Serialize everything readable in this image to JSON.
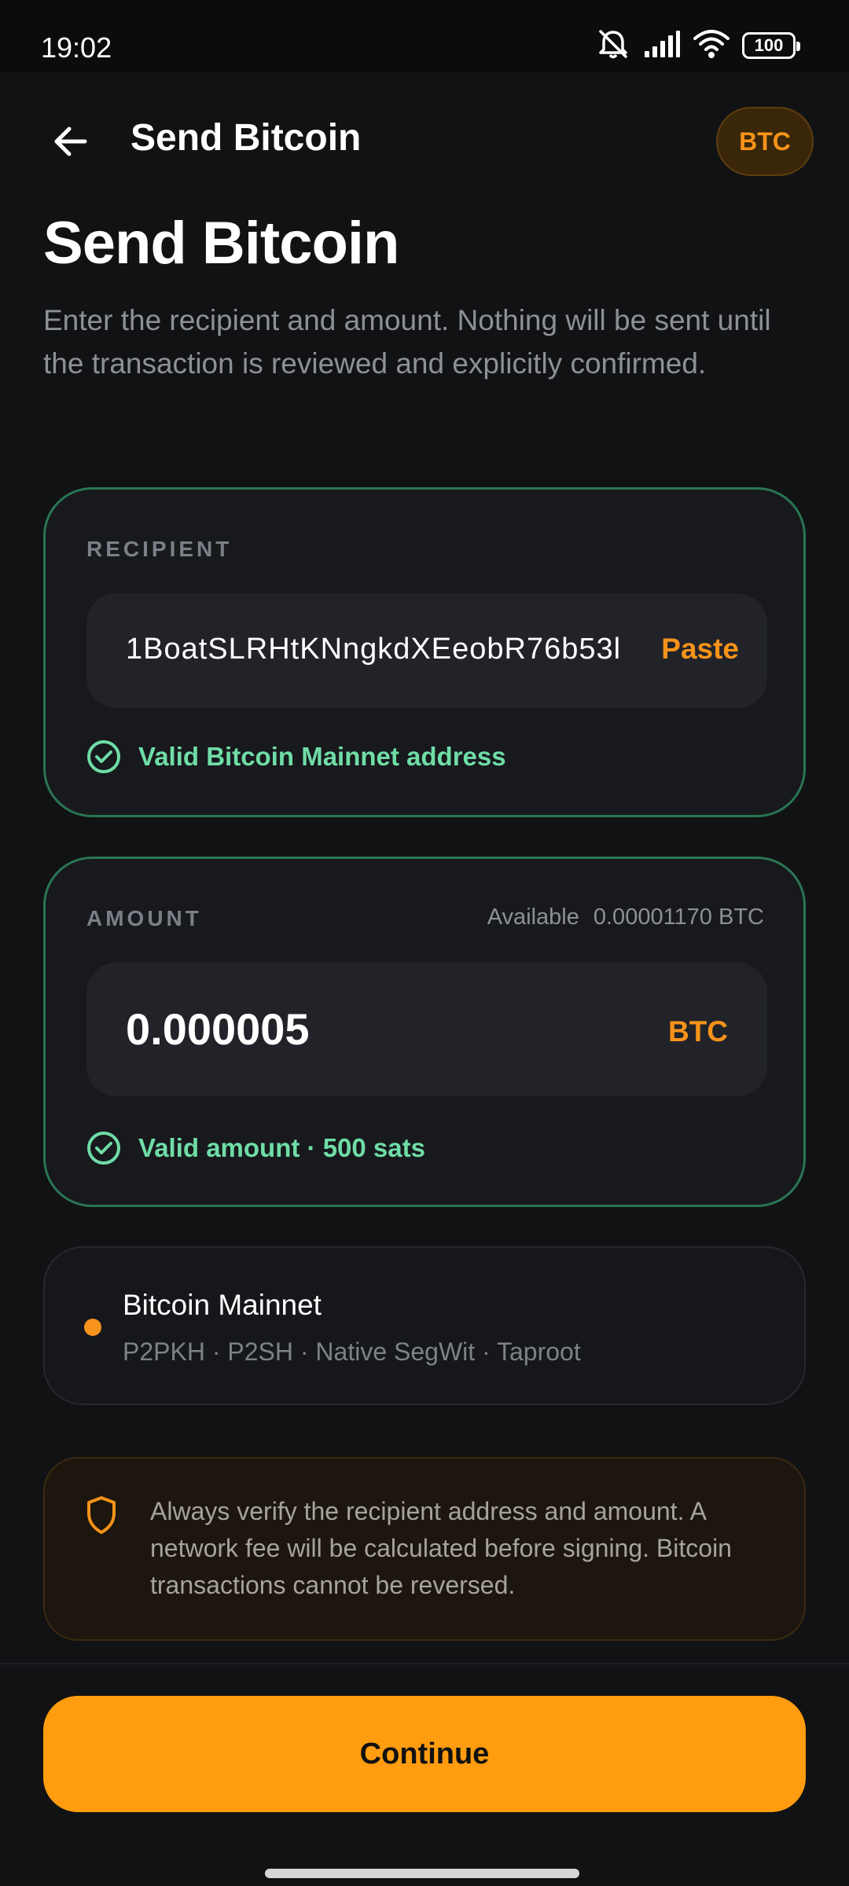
{
  "status_bar": {
    "time": "19:02",
    "battery": "100",
    "icons": [
      "mute-icon",
      "signal-icon",
      "wifi-icon",
      "battery-icon"
    ]
  },
  "header": {
    "back_icon": "arrow-left-icon",
    "title": "Send Bitcoin",
    "chip": "BTC"
  },
  "intro": {
    "title": "Send Bitcoin",
    "subtitle": "Enter the recipient and amount. Nothing will be sent until the transaction is reviewed and explicitly confirmed."
  },
  "recipient": {
    "label": "RECIPIENT",
    "value": "1BoatSLRHtKNngkdXEeobR76b53l",
    "paste_label": "Paste",
    "validation": "Valid Bitcoin Mainnet address"
  },
  "amount": {
    "label": "AMOUNT",
    "available_label": "Available",
    "available_value": "0.00001170 BTC",
    "value": "0.000005",
    "unit": "BTC",
    "validation": "Valid amount · 500 sats"
  },
  "network": {
    "name": "Bitcoin Mainnet",
    "types": "P2PKH · P2SH · Native SegWit · Taproot"
  },
  "warning": {
    "icon": "shield-icon",
    "text": "Always verify the recipient address and amount. A network fee will be calculated before signing. Bitcoin transactions cannot be reversed."
  },
  "footer": {
    "continue_label": "Continue"
  },
  "colors": {
    "accent": "#f7931a",
    "button": "#ff9c0f",
    "success": "#6fdda6",
    "card_border": "#2a7552"
  }
}
